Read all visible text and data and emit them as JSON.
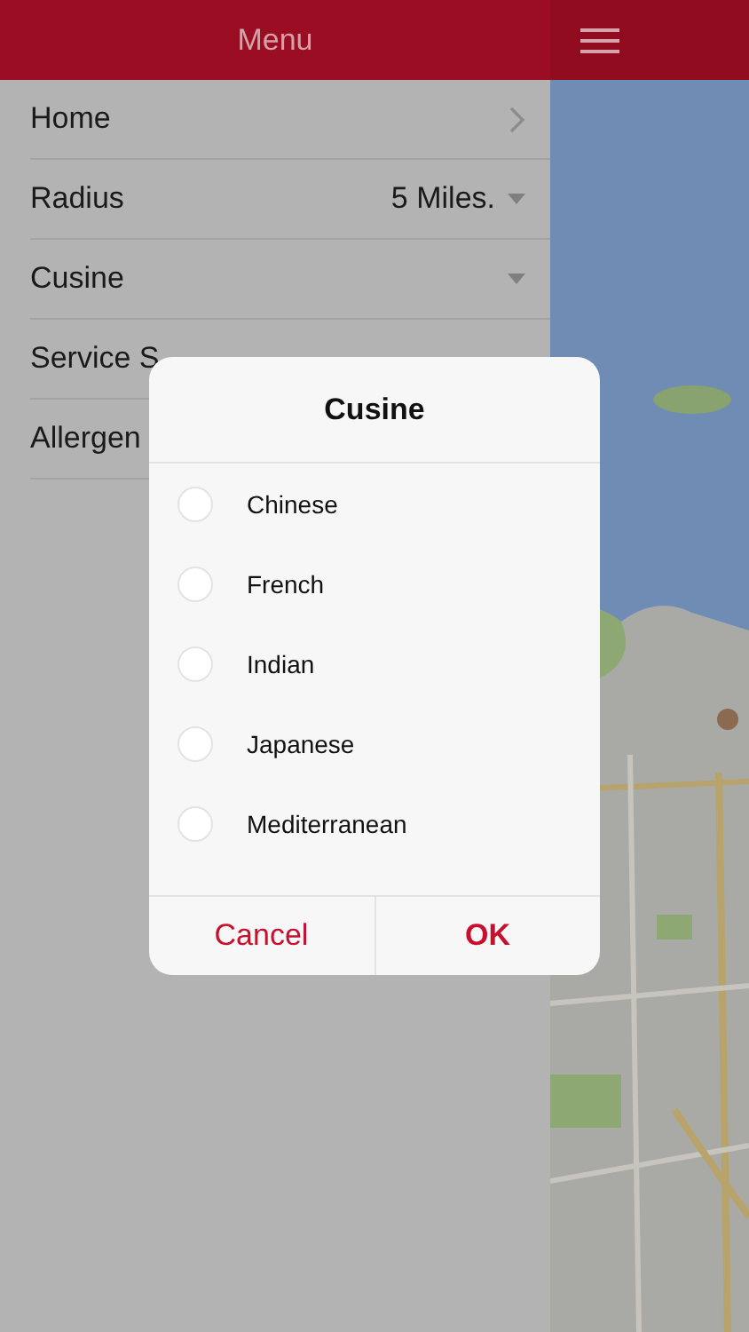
{
  "menu": {
    "title": "Menu",
    "items": [
      {
        "label": "Home",
        "kind": "link"
      },
      {
        "label": "Radius",
        "kind": "dropdown",
        "value": "5 Miles."
      },
      {
        "label": "Cusine",
        "kind": "dropdown"
      },
      {
        "label": "Service S",
        "kind": "hidden"
      },
      {
        "label": "Allergen",
        "kind": "hidden"
      }
    ]
  },
  "dialog": {
    "title": "Cusine",
    "options": [
      {
        "label": "Chinese",
        "selected": false
      },
      {
        "label": "French",
        "selected": false
      },
      {
        "label": "Indian",
        "selected": false
      },
      {
        "label": "Japanese",
        "selected": false
      },
      {
        "label": "Mediterranean",
        "selected": false
      }
    ],
    "buttons": [
      {
        "label": "Cancel",
        "kind": "cancel"
      },
      {
        "label": "OK",
        "kind": "confirm"
      }
    ]
  }
}
